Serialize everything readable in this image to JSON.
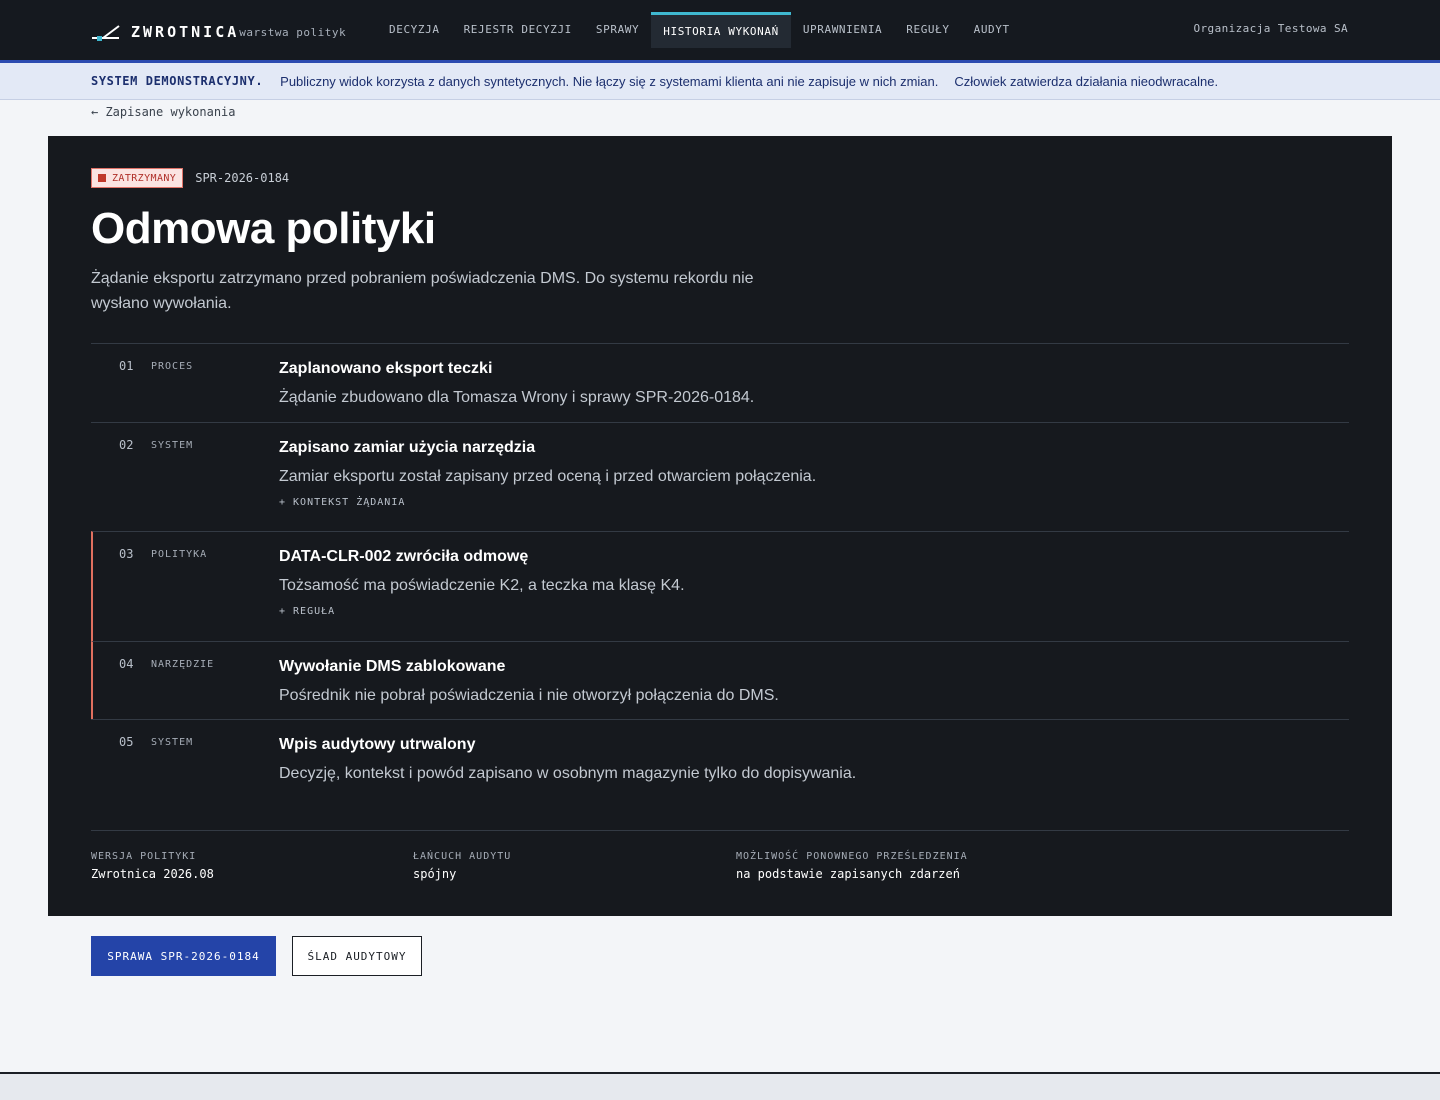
{
  "brand": {
    "name": "ZWROTNICA",
    "subtitle": "warstwa polityk"
  },
  "nav": {
    "items": [
      {
        "label": "DECYZJA",
        "active": false
      },
      {
        "label": "REJESTR DECYZJI",
        "active": false
      },
      {
        "label": "SPRAWY",
        "active": false
      },
      {
        "label": "HISTORIA WYKONAŃ",
        "active": true
      },
      {
        "label": "UPRAWNIENIA",
        "active": false
      },
      {
        "label": "REGUŁY",
        "active": false
      },
      {
        "label": "AUDYT",
        "active": false
      }
    ],
    "organization": "Organizacja Testowa SA"
  },
  "banner": {
    "label": "SYSTEM DEMONSTRACYJNY.",
    "text1": "Publiczny widok korzysta z danych syntetycznych. Nie łączy się z systemami klienta ani nie zapisuje w nich zmian.",
    "text2": "Człowiek zatwierdza działania nieodwracalne."
  },
  "back_link": "← Zapisane wykonania",
  "run": {
    "status": "ZATRZYMANY",
    "case_id": "SPR-2026-0184",
    "title": "Odmowa polityki",
    "description": "Żądanie eksportu zatrzymano przed pobraniem poświadczenia DMS. Do systemu rekordu nie wysłano wywołania."
  },
  "steps": [
    {
      "num": "01",
      "category": "PROCES",
      "title": "Zaplanowano eksport teczki",
      "description": "Żądanie zbudowano dla Tomasza Wrony i sprawy SPR-2026-0184.",
      "expand": ""
    },
    {
      "num": "02",
      "category": "SYSTEM",
      "title": "Zapisano zamiar użycia narzędzia",
      "description": "Zamiar eksportu został zapisany przed oceną i przed otwarciem połączenia.",
      "expand": "+ KONTEKST ŻĄDANIA"
    },
    {
      "num": "03",
      "category": "POLITYKA",
      "title": "DATA-CLR-002 zwróciła odmowę",
      "description": "Tożsamość ma poświadczenie K2, a teczka ma klasę K4.",
      "expand": "+ REGUŁA"
    },
    {
      "num": "04",
      "category": "NARZĘDZIE",
      "title": "Wywołanie DMS zablokowane",
      "description": "Pośrednik nie pobrał poświadczenia i nie otworzył połączenia do DMS.",
      "expand": ""
    },
    {
      "num": "05",
      "category": "SYSTEM",
      "title": "Wpis audytowy utrwalony",
      "description": "Decyzję, kontekst i powód zapisano w osobnym magazynie tylko do dopisywania.",
      "expand": ""
    }
  ],
  "meta": {
    "policy_version_label": "WERSJA POLITYKI",
    "policy_version_value": "Zwrotnica 2026.08",
    "audit_chain_label": "ŁAŃCUCH AUDYTU",
    "audit_chain_value": "spójny",
    "replay_label": "MOŻLIWOŚĆ PONOWNEGO PRZEŚLEDZENIA",
    "replay_value": "na podstawie zapisanych zdarzeń"
  },
  "actions": {
    "case_button": "SPRAWA SPR-2026-0184",
    "audit_button": "ŚLAD AUDYTOWY"
  },
  "colors": {
    "accent": "#2444a8",
    "nav_active": "#3fb8d0",
    "denied": "#e0705f"
  }
}
